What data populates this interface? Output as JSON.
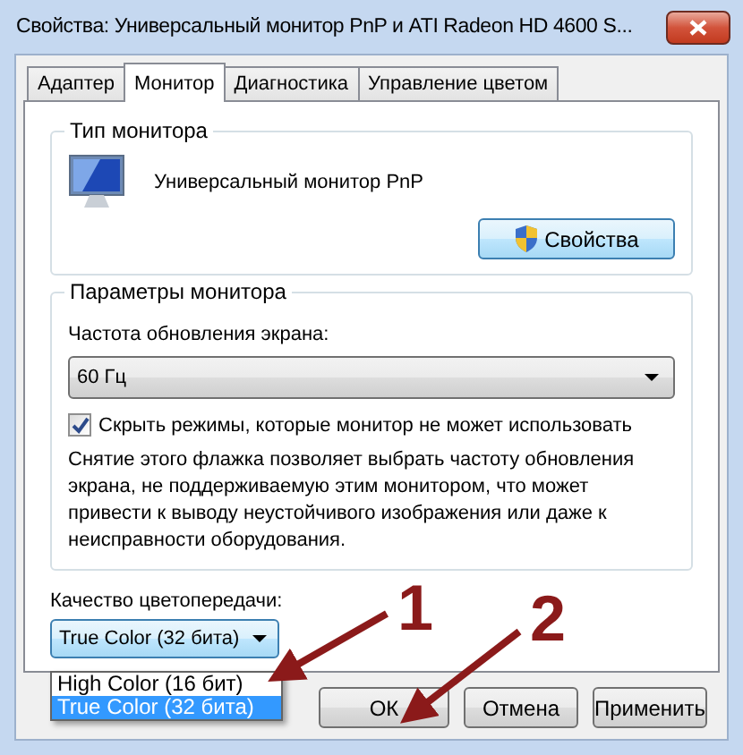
{
  "window": {
    "title": "Свойства: Универсальный монитор PnP и ATI Radeon HD 4600 S..."
  },
  "tabs": [
    {
      "label": "Адаптер",
      "selected": false
    },
    {
      "label": "Монитор",
      "selected": true
    },
    {
      "label": "Диагностика",
      "selected": false
    },
    {
      "label": "Управление цветом",
      "selected": false
    }
  ],
  "monitor_type": {
    "title": "Тип монитора",
    "name": "Универсальный монитор PnP",
    "properties_button": "Свойства"
  },
  "monitor_settings": {
    "title": "Параметры монитора",
    "refresh_label": "Частота обновления экрана:",
    "refresh_value": "60 Гц",
    "hide_modes": {
      "label": "Скрыть режимы, которые монитор не может использовать",
      "checked": true
    },
    "note": "Снятие этого флажка позволяет выбрать частоту обновления экрана, не поддерживаемую этим монитором, что может привести к выводу неустойчивого изображения или даже к неисправности оборудования."
  },
  "color_quality": {
    "label": "Качество цветопередачи:",
    "value": "True Color (32 бита)",
    "expanded": true,
    "options": [
      {
        "label": "High Color (16 бит)",
        "selected": false
      },
      {
        "label": "True Color (32 бита)",
        "selected": true
      }
    ]
  },
  "annotations": [
    "1",
    "2"
  ],
  "buttons": [
    "ОК",
    "Отмена",
    "Применить"
  ]
}
